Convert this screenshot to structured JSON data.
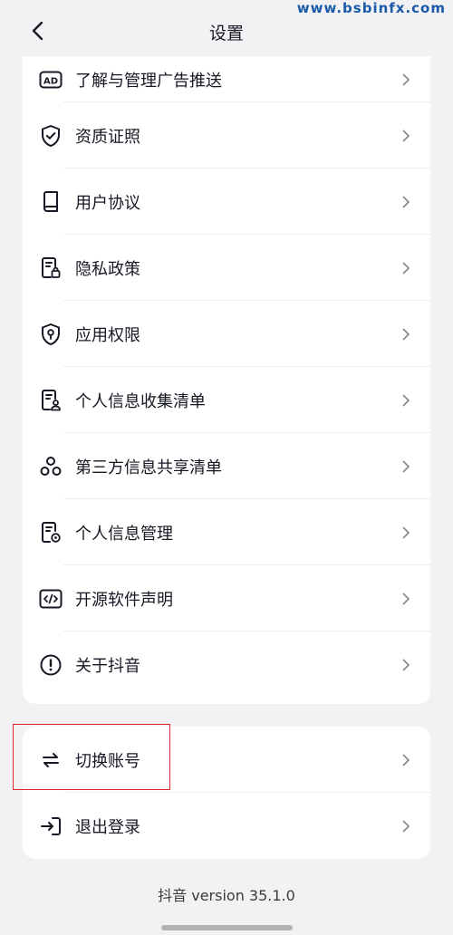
{
  "watermark": "www.bsbinfx.com",
  "header": {
    "title": "设置"
  },
  "menu_group_1": [
    {
      "label": "了解与管理广告推送",
      "icon": "ad-icon"
    },
    {
      "label": "资质证照",
      "icon": "shield-check-icon"
    },
    {
      "label": "用户协议",
      "icon": "book-icon"
    },
    {
      "label": "隐私政策",
      "icon": "document-lock-icon"
    },
    {
      "label": "应用权限",
      "icon": "shield-key-icon"
    },
    {
      "label": "个人信息收集清单",
      "icon": "document-person-icon"
    },
    {
      "label": "第三方信息共享清单",
      "icon": "share-nodes-icon"
    },
    {
      "label": "个人信息管理",
      "icon": "document-settings-icon"
    },
    {
      "label": "开源软件声明",
      "icon": "code-icon"
    },
    {
      "label": "关于抖音",
      "icon": "info-icon"
    }
  ],
  "menu_group_2": [
    {
      "label": "切换账号",
      "icon": "switch-arrows-icon"
    },
    {
      "label": "退出登录",
      "icon": "logout-icon"
    }
  ],
  "footer": {
    "version_text": "抖音 version 35.1.0"
  },
  "colors": {
    "highlight_border": "#e0262c",
    "background": "#f2f2f4",
    "card": "#ffffff"
  }
}
